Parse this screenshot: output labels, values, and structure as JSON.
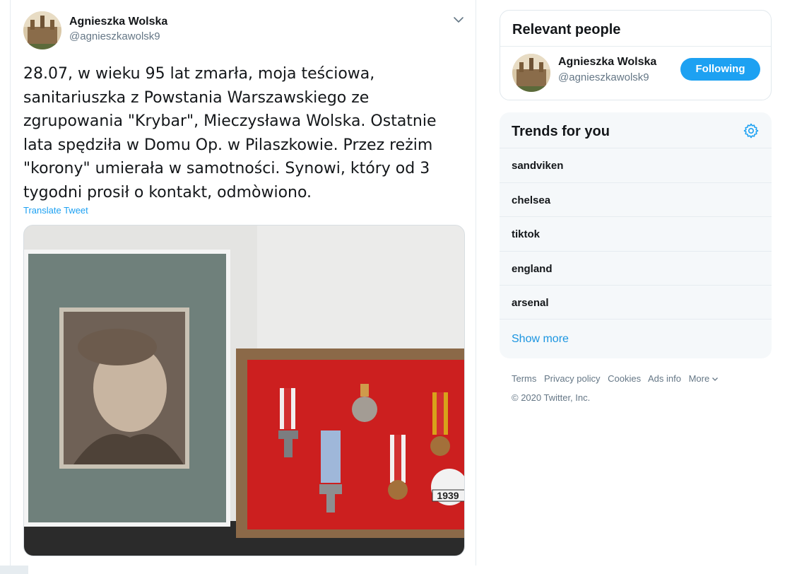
{
  "tweet": {
    "author_name": "Agnieszka Wolska",
    "author_handle": "@agnieszkawolsk9",
    "text": "28.07, w wieku 95 lat zmarła, moja teściowa,\nsanitariuszka z Powstania Warszawskiego ze\nzgrupowania \"Krybar\", Mieczysława Wolska. Ostatnie\nlata spędziła w Domu Op. w Pilaszkowie. Przez reżim\n\"korony\" umierała w samotności. Synowi, który od 3\ntygodni prosił o kontakt, odmòwiono.",
    "translate_label": "Translate Tweet",
    "media_badge": "1939",
    "caret_icon": "chevron-down-icon"
  },
  "relevant_people": {
    "title": "Relevant people",
    "person": {
      "name": "Agnieszka Wolska",
      "handle": "@agnieszkawolsk9",
      "follow_label": "Following"
    }
  },
  "trends": {
    "title": "Trends for you",
    "settings_icon": "gear-icon",
    "items": [
      {
        "label": "sandviken"
      },
      {
        "label": "chelsea"
      },
      {
        "label": "tiktok"
      },
      {
        "label": "england"
      },
      {
        "label": "arsenal"
      }
    ],
    "show_more": "Show more"
  },
  "footer": {
    "links": [
      "Terms",
      "Privacy policy",
      "Cookies",
      "Ads info"
    ],
    "more_label": "More",
    "copyright": "© 2020 Twitter, Inc."
  },
  "colors": {
    "accent": "#1da1f2",
    "link": "#1b95e0",
    "secondary_text": "#657786",
    "primary_text": "#14171a",
    "trends_bg": "#f5f8fa"
  }
}
